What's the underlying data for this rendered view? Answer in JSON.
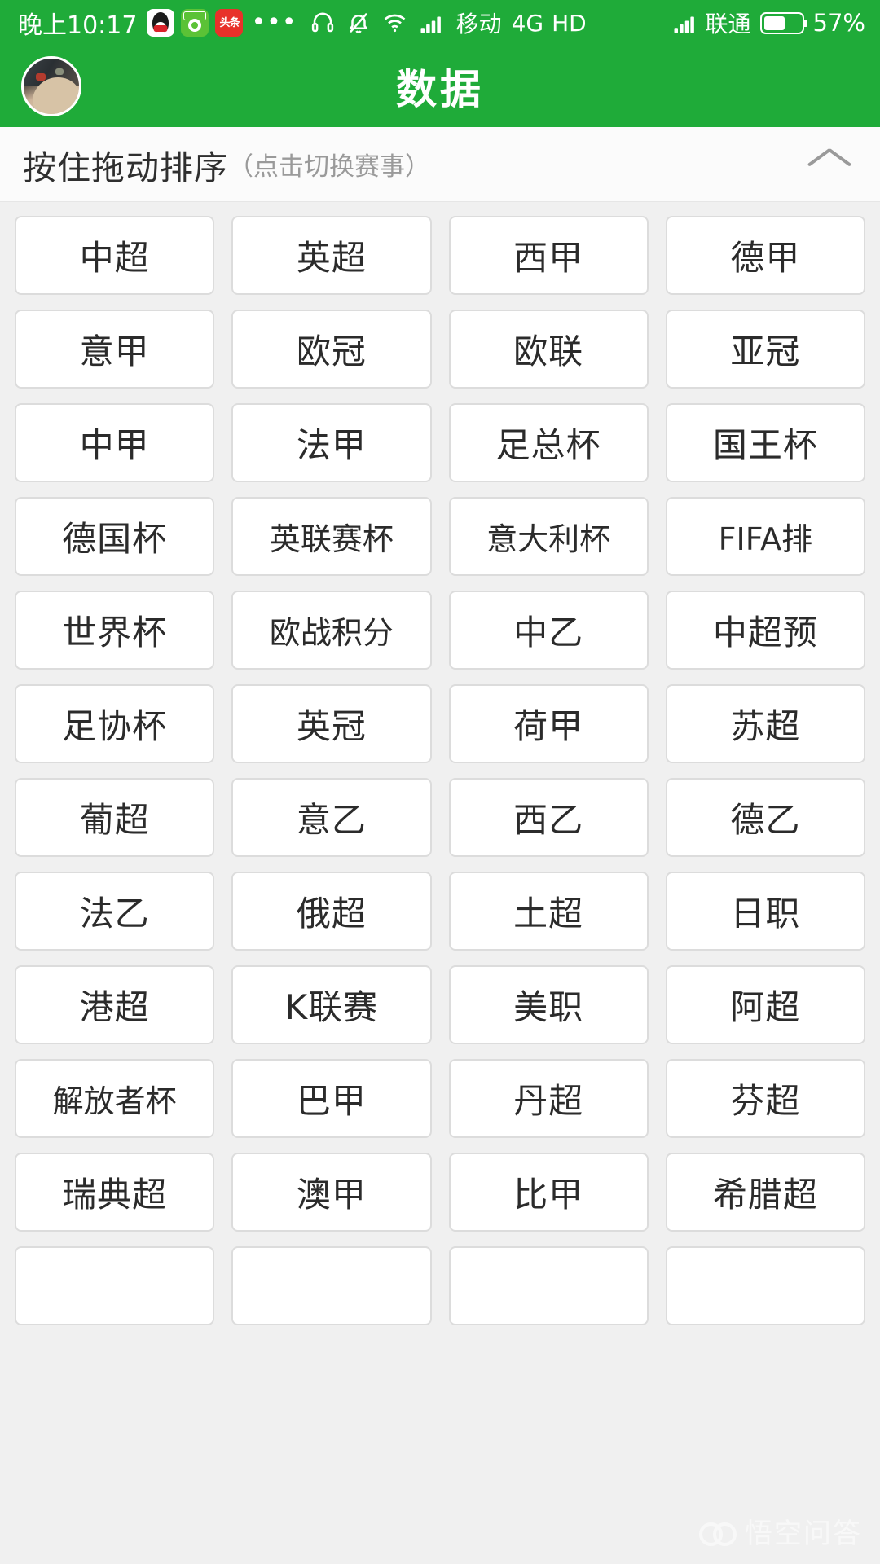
{
  "status_bar": {
    "time": "晚上10:17",
    "app_icons": [
      {
        "name": "qq-icon",
        "label": "QQ"
      },
      {
        "name": "football-app-icon",
        "label": "球"
      },
      {
        "name": "toutiao-icon",
        "label": "头条"
      }
    ],
    "overflow_dots": "•••",
    "icons": [
      "headset-icon",
      "bell-muted-icon",
      "wifi-icon",
      "signal-bars-icon"
    ],
    "carrier_primary": "移动",
    "network_type": "4G",
    "hd_label": "HD",
    "carrier_secondary": "联通",
    "battery_percent": "57%",
    "battery_level": 57
  },
  "header": {
    "title": "数据",
    "avatar_name": "user-avatar"
  },
  "section": {
    "title": "按住拖动排序",
    "subtitle": "（点击切换赛事）",
    "collapse_icon": "chevron-up-icon"
  },
  "colors": {
    "brand_green": "#1fab39",
    "page_bg": "#f0f0f0",
    "tile_bg": "#ffffff",
    "tile_border": "#dcdcdc",
    "text_primary": "#2b2b2b",
    "text_muted": "#9a9a9a"
  },
  "leagues": [
    "中超",
    "英超",
    "西甲",
    "德甲",
    "意甲",
    "欧冠",
    "欧联",
    "亚冠",
    "中甲",
    "法甲",
    "足总杯",
    "国王杯",
    "德国杯",
    "英联赛杯",
    "意大利杯",
    "FIFA排",
    "世界杯",
    "欧战积分",
    "中乙",
    "中超预",
    "足协杯",
    "英冠",
    "荷甲",
    "苏超",
    "葡超",
    "意乙",
    "西乙",
    "德乙",
    "法乙",
    "俄超",
    "土超",
    "日职",
    "港超",
    "K联赛",
    "美职",
    "阿超",
    "解放者杯",
    "巴甲",
    "丹超",
    "芬超",
    "瑞典超",
    "澳甲",
    "比甲",
    "希腊超",
    "",
    "",
    "",
    ""
  ],
  "watermark": {
    "text": "悟空问答"
  }
}
